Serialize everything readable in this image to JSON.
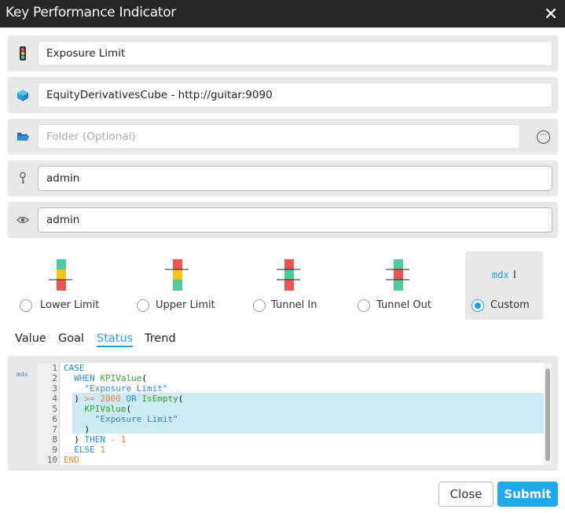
{
  "dialog": {
    "title": "Key Performance Indicator"
  },
  "fields": {
    "name": {
      "value": "Exposure Limit",
      "icon": "traffic-light-icon"
    },
    "cube": {
      "value": "EquityDerivativesCube - http://guitar:9090",
      "icon": "cube-icon"
    },
    "folder": {
      "placeholder": "Folder (Optional)",
      "icon": "folder-icon",
      "more_label": "···"
    },
    "owner": {
      "value": "admin",
      "icon": "key-icon"
    },
    "viewer": {
      "value": "admin",
      "icon": "eye-icon"
    }
  },
  "kpi_types": [
    {
      "label": "Lower Limit",
      "selected": false
    },
    {
      "label": "Upper Limit",
      "selected": false
    },
    {
      "label": "Tunnel In",
      "selected": false
    },
    {
      "label": "Tunnel Out",
      "selected": false
    },
    {
      "label": "Custom",
      "selected": true,
      "icon_text": "mdx"
    }
  ],
  "tabs": [
    {
      "label": "Value",
      "active": false
    },
    {
      "label": "Goal",
      "active": false
    },
    {
      "label": "Status",
      "active": true
    },
    {
      "label": "Trend",
      "active": false
    }
  ],
  "editor": {
    "side_label": "mdx",
    "lines": [
      {
        "n": "1",
        "tokens": [
          [
            "kw",
            "CASE"
          ]
        ]
      },
      {
        "n": "2",
        "tokens": [
          [
            "",
            "  "
          ],
          [
            "kw",
            "WHEN"
          ],
          [
            "",
            " "
          ],
          [
            "fn",
            "KPIValue"
          ],
          [
            "",
            "("
          ]
        ]
      },
      {
        "n": "3",
        "tokens": [
          [
            "",
            "    "
          ],
          [
            "str",
            "\"Exposure Limit\""
          ]
        ]
      },
      {
        "n": "4",
        "tokens": [
          [
            "",
            "  ) "
          ],
          [
            "op",
            ">="
          ],
          [
            "",
            " "
          ],
          [
            "num-lit",
            "2000"
          ],
          [
            "",
            " "
          ],
          [
            "kw",
            "OR"
          ],
          [
            "",
            " "
          ],
          [
            "fn",
            "IsEmpty"
          ],
          [
            "",
            "("
          ]
        ]
      },
      {
        "n": "5",
        "tokens": [
          [
            "",
            "    "
          ],
          [
            "fn",
            "KPIValue"
          ],
          [
            "",
            "("
          ]
        ]
      },
      {
        "n": "6",
        "tokens": [
          [
            "",
            "      "
          ],
          [
            "str",
            "\"Exposure Limit\""
          ]
        ]
      },
      {
        "n": "7",
        "tokens": [
          [
            "",
            "    )"
          ]
        ]
      },
      {
        "n": "8",
        "tokens": [
          [
            "",
            "  ) "
          ],
          [
            "kw",
            "THEN"
          ],
          [
            "",
            " "
          ],
          [
            "op",
            "-"
          ],
          [
            "",
            " "
          ],
          [
            "num-lit",
            "1"
          ]
        ]
      },
      {
        "n": "9",
        "tokens": [
          [
            "",
            "  "
          ],
          [
            "kw",
            "ELSE"
          ],
          [
            "",
            " "
          ],
          [
            "num-lit",
            "1"
          ]
        ]
      },
      {
        "n": "10",
        "tokens": [
          [
            "num-lit",
            "END"
          ]
        ]
      }
    ]
  },
  "buttons": {
    "close": "Close",
    "submit": "Submit"
  },
  "colors": {
    "accent": "#1fa1e6",
    "green": "#4ecb9c",
    "red": "#f05454",
    "yellow": "#f2c419"
  }
}
